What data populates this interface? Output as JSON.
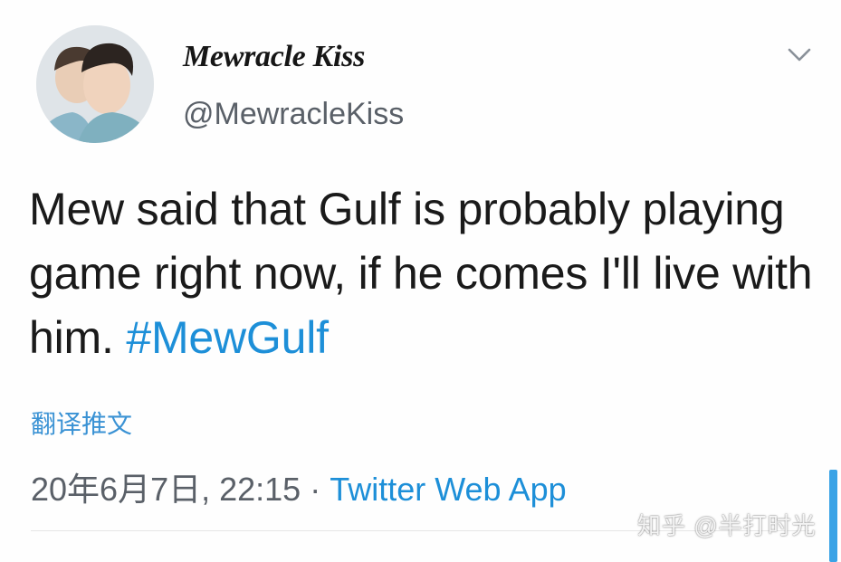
{
  "tweet": {
    "display_name": "Mewracle Kiss",
    "handle": "@MewracleKiss",
    "text_main": "Mew said that Gulf is probably playing game right now, if he comes I'll live with him. ",
    "hashtag": "#MewGulf",
    "translate_label": "翻译推文",
    "date": "20年6月7日, 22:15",
    "separator": " · ",
    "source": "Twitter Web App"
  },
  "watermark": {
    "text": "知乎 @半打时光"
  },
  "icons": {
    "avatar": "avatar-photo",
    "menu": "chevron-down-icon"
  },
  "colors": {
    "link": "#1d8fd8",
    "muted": "#5a6068",
    "text": "#1a1a1a"
  }
}
